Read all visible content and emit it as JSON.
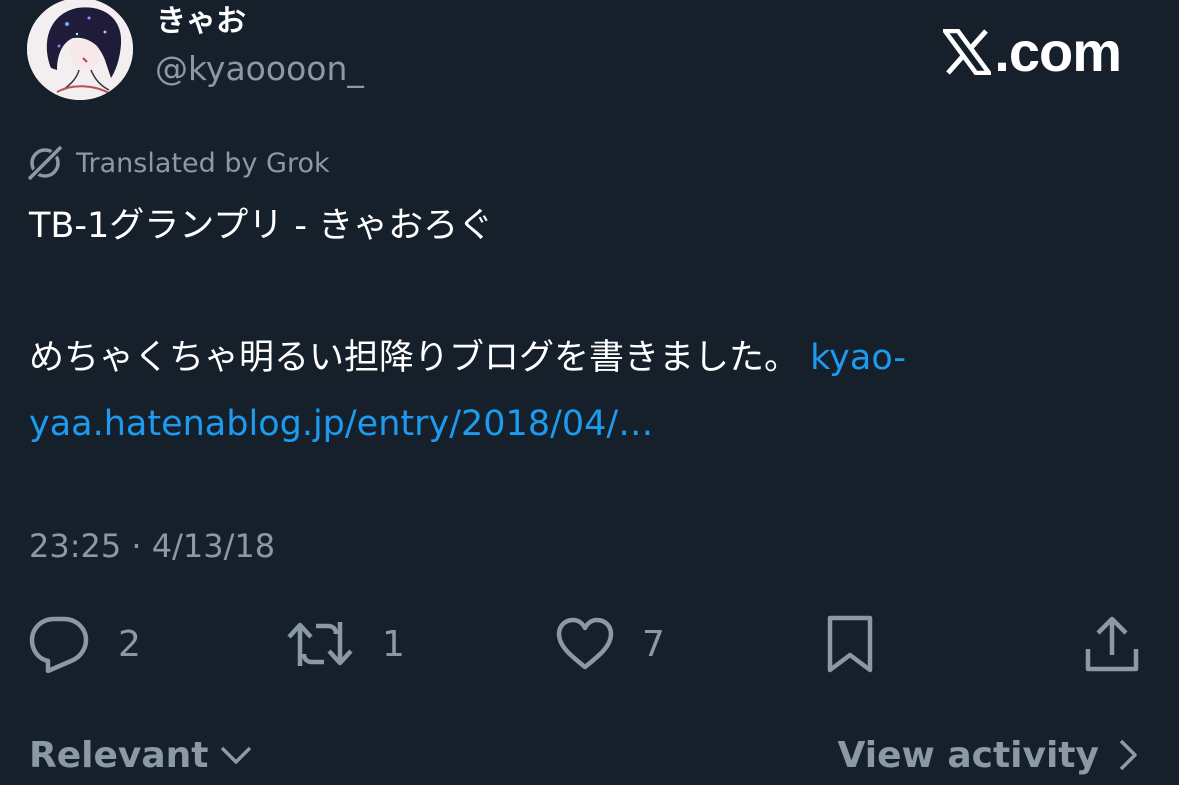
{
  "author": {
    "display_name": "きゃお",
    "handle": "@kyaoooon_"
  },
  "brand": {
    "label": ".com",
    "icon": "x-logo-icon"
  },
  "translation": {
    "label": "Translated by Grok",
    "icon": "grok-icon"
  },
  "tweet": {
    "line1": "TB-1グランプリ - きゃおろぐ",
    "line2_text": "めちゃくちゃ明るい担降りブログを書きました。 ",
    "line2_link": "kyao-",
    "line3_link": "yaa.hatenablog.jp/entry/2018/04/…"
  },
  "timestamp": "23:25 · 4/13/18",
  "actions": {
    "replies": "2",
    "reposts": "1",
    "likes": "7"
  },
  "footer": {
    "sort_label": "Relevant",
    "view_activity_label": "View activity"
  },
  "colors": {
    "background": "#15202b",
    "text": "#ffffff",
    "secondary": "#8b98a5",
    "link": "#1d9bf0"
  }
}
